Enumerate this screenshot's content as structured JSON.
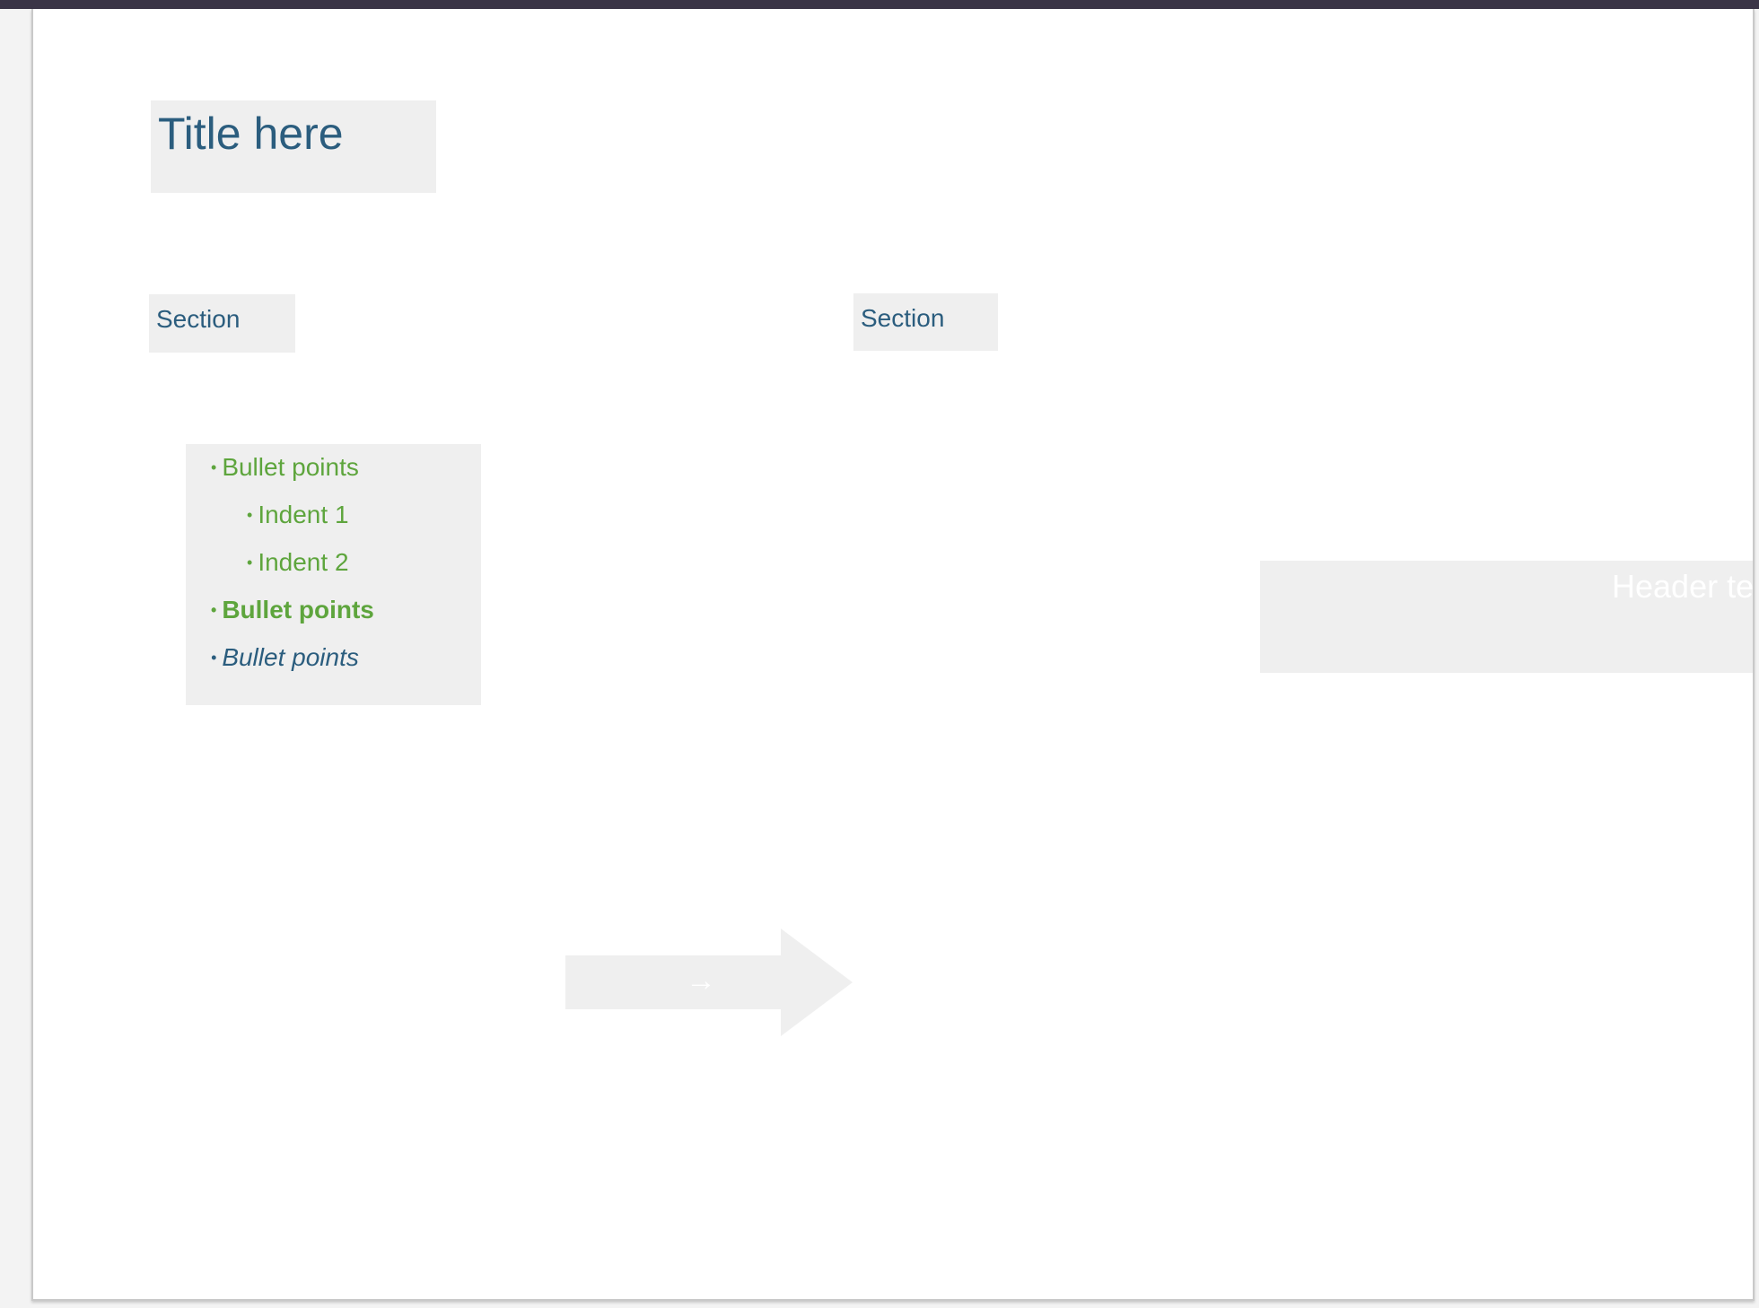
{
  "slide": {
    "title": "Title here",
    "sections": [
      "Section",
      "Section"
    ],
    "bullets": [
      {
        "text": "Bullet points",
        "level": 0,
        "style": "normal"
      },
      {
        "text": "Indent 1",
        "level": 1,
        "style": "normal"
      },
      {
        "text": "Indent 2",
        "level": 1,
        "style": "normal"
      },
      {
        "text": "Bullet points",
        "level": 0,
        "style": "bold"
      },
      {
        "text": "Bullet points",
        "level": 0,
        "style": "italic"
      }
    ],
    "header_text": "Header te",
    "arrow_label": "→",
    "bullet_symbol": "•"
  },
  "colors": {
    "topbar": "#3a3446",
    "placeholder_bg": "#efefef",
    "title_blue": "#2b5d7e",
    "bullet_green": "#5ea53d"
  }
}
